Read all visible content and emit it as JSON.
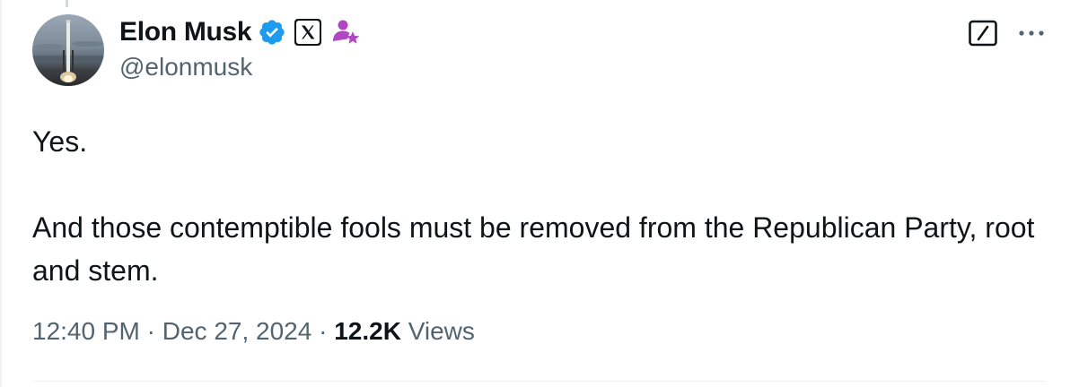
{
  "author": {
    "display_name": "Elon Musk",
    "handle": "@elonmusk",
    "verified_color": "#1d9bf0",
    "role_badge_color": "#b146c2"
  },
  "tweet": {
    "paragraphs": [
      "Yes.",
      "And those contemptible fools must be removed from the Republican Party, root and stem."
    ]
  },
  "meta": {
    "time": "12:40 PM",
    "separator": "·",
    "date": "Dec 27, 2024",
    "views_count": "12.2K",
    "views_label": "Views"
  },
  "icons": {
    "avatar": "rocket-launch-avatar",
    "verified": "verified-checkmark-icon",
    "affiliate": "x-logo-icon",
    "role": "person-star-icon",
    "grok": "grok-icon",
    "more": "more-horizontal-icon"
  }
}
